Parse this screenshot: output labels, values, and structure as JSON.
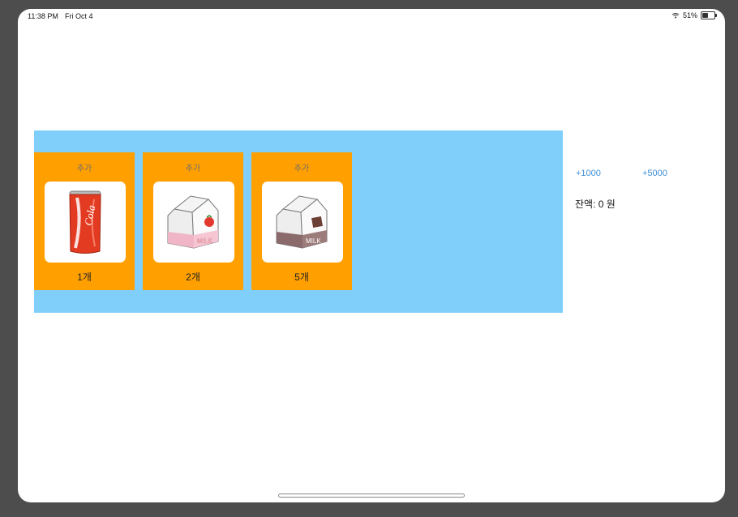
{
  "status_bar": {
    "time": "11:38 PM",
    "date": "Fri Oct 4",
    "battery": "51%"
  },
  "products": [
    {
      "add_label": "추가",
      "image": "cola-can",
      "count": "1개"
    },
    {
      "add_label": "추가",
      "image": "strawberry-milk-carton",
      "count": "2개"
    },
    {
      "add_label": "추가",
      "image": "chocolate-milk-carton",
      "count": "5개"
    }
  ],
  "controls": {
    "add_1000": "+1000",
    "add_5000": "+5000",
    "balance": "잔액: 0 원"
  },
  "colors": {
    "shelf": "#80cffb",
    "card": "#ff9f00",
    "link": "#3f8fd6"
  }
}
